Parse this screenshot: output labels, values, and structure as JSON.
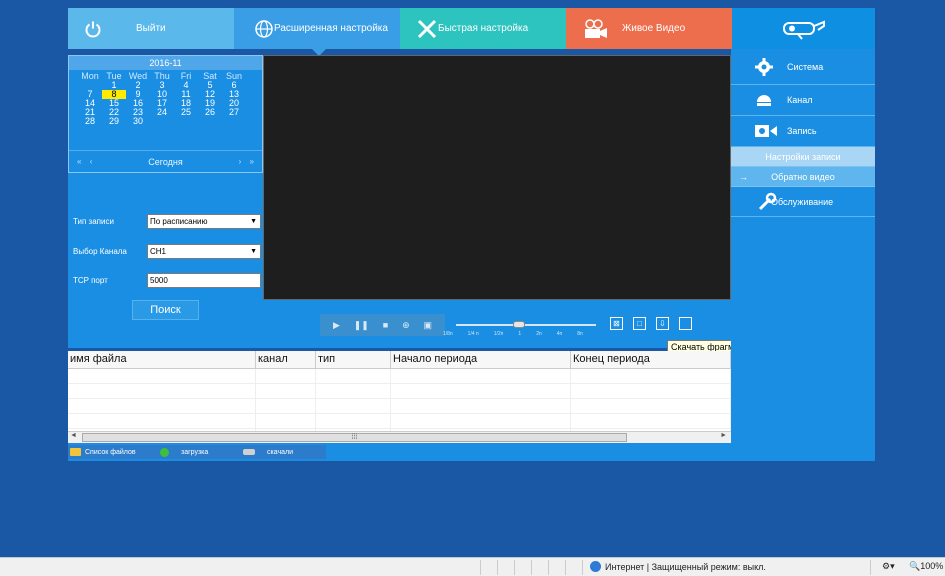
{
  "nav": {
    "exit": "Выйти",
    "advanced": "Расширенная настройка",
    "quick": "Быстрая настройка",
    "live": "Живое Видео"
  },
  "calendar": {
    "title": "2016-11",
    "weekdays": [
      "Mon",
      "Tue",
      "Wed",
      "Thu",
      "Fri",
      "Sat",
      "Sun"
    ],
    "weeks": [
      [
        "",
        "1",
        "2",
        "3",
        "4",
        "5",
        "6"
      ],
      [
        "7",
        "8",
        "9",
        "10",
        "11",
        "12",
        "13"
      ],
      [
        "14",
        "15",
        "16",
        "17",
        "18",
        "19",
        "20"
      ],
      [
        "21",
        "22",
        "23",
        "24",
        "25",
        "26",
        "27"
      ],
      [
        "28",
        "29",
        "30",
        "",
        "",
        "",
        ""
      ]
    ],
    "selected_day": "8",
    "prev_year": "«",
    "prev_month": "‹",
    "today": "Сегодня",
    "next_month": "›",
    "next_year": "»"
  },
  "form": {
    "record_type_label": "Тип записи",
    "record_type_value": "По расписанию",
    "channel_label": "Выбор Канала",
    "channel_value": "CH1",
    "tcp_label": "TCP порт",
    "tcp_value": "5000",
    "search_button": "Поиск"
  },
  "playback": {
    "speeds": [
      "1/8п",
      "1/4 п",
      "1/2п",
      "1",
      "2п",
      "4п",
      "8п"
    ],
    "speed_position": 0.45
  },
  "tooltip": "Скачать фрагмент",
  "table": {
    "columns": [
      "имя файла",
      "канал",
      "тип",
      "Начало периода",
      "Конец периода"
    ],
    "rows": 5
  },
  "bottom_tabs": {
    "file_list": "Список файлов",
    "download": "загрузка",
    "downloaded": "скачали"
  },
  "sidebar": {
    "system": "Система",
    "channel": "Канал",
    "record": "Запись",
    "record_settings": "Настройки записи",
    "playback": "Обратно видео",
    "maintenance": "Обслуживание"
  },
  "statusbar": {
    "zone": "Интернет | Защищенный режим: выкл.",
    "zoom": "100%"
  },
  "colors": {
    "background": "#1a58a6",
    "panel": "#1a8ee2",
    "exit_tab": "#5bb8ea",
    "advanced_tab": "#3a9ee6",
    "quick_tab": "#2dc4c0",
    "live_tab": "#ec6e4c",
    "selected_day": "#ffeb00"
  }
}
